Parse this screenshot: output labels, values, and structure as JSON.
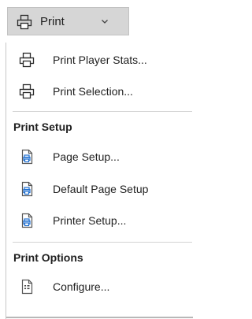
{
  "print_button": {
    "label": "Print",
    "icon": "printer-icon",
    "dropdown_icon": "chevron-down-icon"
  },
  "menu": {
    "print_items": [
      {
        "label": "Print Player Stats...",
        "icon": "printer-icon"
      },
      {
        "label": "Print Selection...",
        "icon": "printer-icon"
      }
    ],
    "print_setup": {
      "header": "Print Setup",
      "items": [
        {
          "label": "Page Setup...",
          "icon": "page-setup-icon"
        },
        {
          "label": "Default Page Setup",
          "icon": "page-setup-icon"
        },
        {
          "label": "Printer Setup...",
          "icon": "page-setup-icon"
        }
      ]
    },
    "print_options": {
      "header": "Print Options",
      "items": [
        {
          "label": "Configure...",
          "icon": "configure-icon"
        }
      ]
    }
  },
  "colors": {
    "button_bg": "#d6d6d6",
    "icon_blue": "#1e6fd0",
    "text": "#1f1f1f"
  }
}
